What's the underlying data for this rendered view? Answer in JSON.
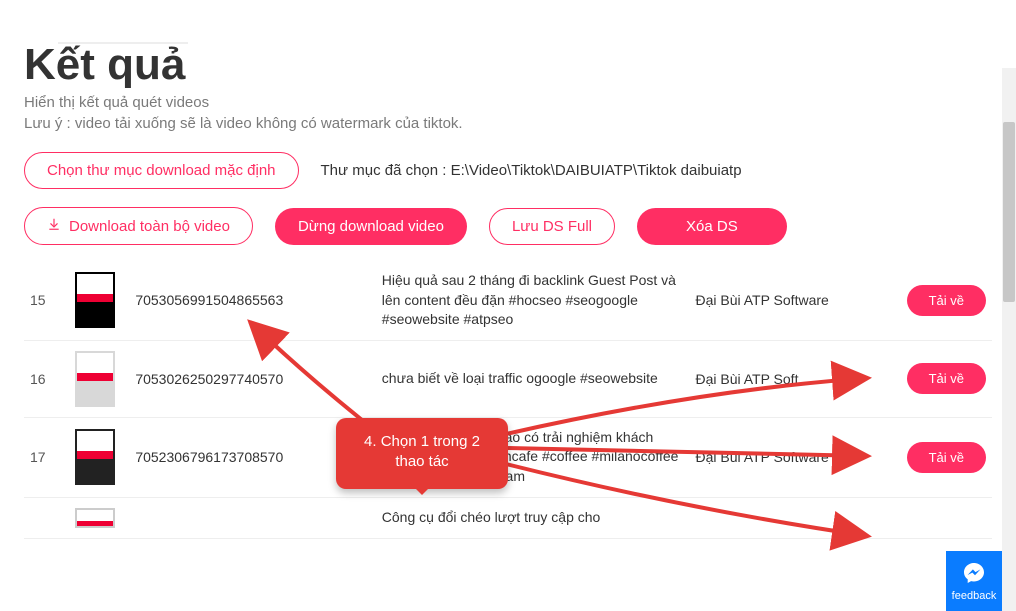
{
  "page": {
    "title": "Kết quả",
    "subtitle": "Hiển thị kết quả quét videos",
    "note": "Lưu ý : video tải xuống sẽ là video không có watermark của tiktok."
  },
  "chooseFolder": {
    "button": "Chọn thư mục download mặc định",
    "label": "Thư mục đã chọn : E:\\Video\\Tiktok\\DAIBUIATP\\Tiktok daibuiatp"
  },
  "actions": {
    "downloadAll": "Download toàn bộ video",
    "stop": "Dừng download video",
    "saveList": "Lưu DS Full",
    "clear": "Xóa DS"
  },
  "rows": [
    {
      "idx": "15",
      "id": "7053056991504865563",
      "desc": "Hiệu quả sau 2 tháng đi backlink Guest Post và lên content đều đặn #hocseo #seogoogle #seowebsite #atpseo",
      "author": "Đại Bùi ATP Software",
      "btn": "Tải về"
    },
    {
      "idx": "16",
      "id": "7053026250297740570",
      "desc": "chưa biết về loại traffic ogoogle #seowebsite",
      "author": "Đại Bùi ATP Soft…",
      "btn": "Tải về"
    },
    {
      "idx": "17",
      "id": "7052306796173708570",
      "desc": "Thương hiệu cafe nào có trải nghiệm khách hàng tốt hơn? #quancafe #coffee #milanocoffee #cafeongbau #atpteam",
      "author": "Đại Bùi ATP Software",
      "btn": "Tải về"
    },
    {
      "idx": "",
      "id": "",
      "desc": "Công cụ đổi chéo lượt truy cập cho",
      "author": "",
      "btn": ""
    }
  ],
  "callout": "4. Chọn 1 trong 2\nthao tác",
  "feedback": "feedback"
}
